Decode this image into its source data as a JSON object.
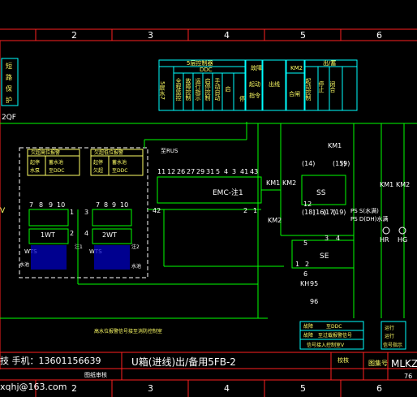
{
  "ruler_top": [
    "2",
    "3",
    "4",
    "5",
    "6"
  ],
  "ruler_bottom": [
    "2",
    "3",
    "4",
    "5",
    "6"
  ],
  "left_table": {
    "chars": [
      "短",
      "路",
      "保",
      "护"
    ]
  },
  "left_label": "2QF",
  "left_edge_label": "V",
  "top_table": {
    "header": "5层控制器",
    "ddc_header": "DDC",
    "col_a": "5层水7",
    "cols": [
      "全程监控",
      "故障控制",
      "运行指示",
      "启停控制",
      "手动自动",
      "启",
      "停",
      "件"
    ]
  },
  "fault_table": {
    "col1": "故障",
    "col2": "启停"
  },
  "start_stop": [
    "起动",
    "指令"
  ],
  "output_label": "出线",
  "km2_table": {
    "header": "KM2",
    "sub": "出/蓄",
    "cols": [
      "合闸",
      "起动控制",
      "停止",
      "闭合"
    ]
  },
  "level_table1": {
    "title": "欠超高位报警",
    "cells": [
      "起停",
      "水泵",
      "蓄水池",
      "至DDC"
    ]
  },
  "level_table2": {
    "title": "欠超低位报警",
    "cells": [
      "起停",
      "欠超",
      "蓄水池",
      "至DDC"
    ]
  },
  "terminals_a": [
    "7",
    "8",
    "9",
    "10"
  ],
  "terminals_b": [
    "7",
    "8",
    "9",
    "10"
  ],
  "sensor_a": "1WT",
  "sensor_b": "2WT",
  "sensor_nums_a": [
    "1",
    "2"
  ],
  "sensor_nums_b": [
    "3",
    "4"
  ],
  "nc_a": "WTS",
  "nc_b": "WTS",
  "note_a": "注1",
  "note_b": "注2",
  "water_a": "水池",
  "water_b": "水池",
  "rus_label": "至RUS",
  "emc_terms": [
    "11",
    "12",
    "26",
    "27",
    "29",
    "31",
    "5",
    "4",
    "3",
    "41",
    "43"
  ],
  "emc_label": "EMC-注1",
  "emc_bottom": [
    "42",
    "2",
    "1"
  ],
  "km1_label": "KM1",
  "km2_label": "KM2",
  "km2_lower": "KM2",
  "ss_label": "SS",
  "ss_nums": [
    "(14)",
    "(18)",
    "12",
    "(16)",
    "(17)",
    "(19)",
    "(15)",
    "(9)"
  ],
  "ps1": "PS S(水满)",
  "ps2": "PS D(DH)水满",
  "se_label": "SE",
  "se_nums": [
    "5",
    "3",
    "4",
    "1",
    "2",
    "6"
  ],
  "kh_label": "KH",
  "kh_nums": [
    "95",
    "96"
  ],
  "km_right": [
    "KM1",
    "KM2"
  ],
  "km_top": "KM1",
  "hr": "HR",
  "hg": "HG",
  "bottom_note": "高水位报警信号接至消防控制室",
  "ddc_box": {
    "r1a": "故障",
    "r1b": "至DDC",
    "r2a": "故障",
    "r2b": "至过载报警信号",
    "r3": "信号接入控制室V"
  },
  "right_box": [
    "运行",
    "运行",
    "信号指示"
  ],
  "title_left": "技 手机：13601156639",
  "title_mid": "U箱(进线)出/备用5FB-2",
  "title_c1": "校核",
  "title_c2": "图集号",
  "title_c3": "MLKZ",
  "title_sub": "图纸审核",
  "page_num": "76",
  "email": "xqhj@163.com"
}
